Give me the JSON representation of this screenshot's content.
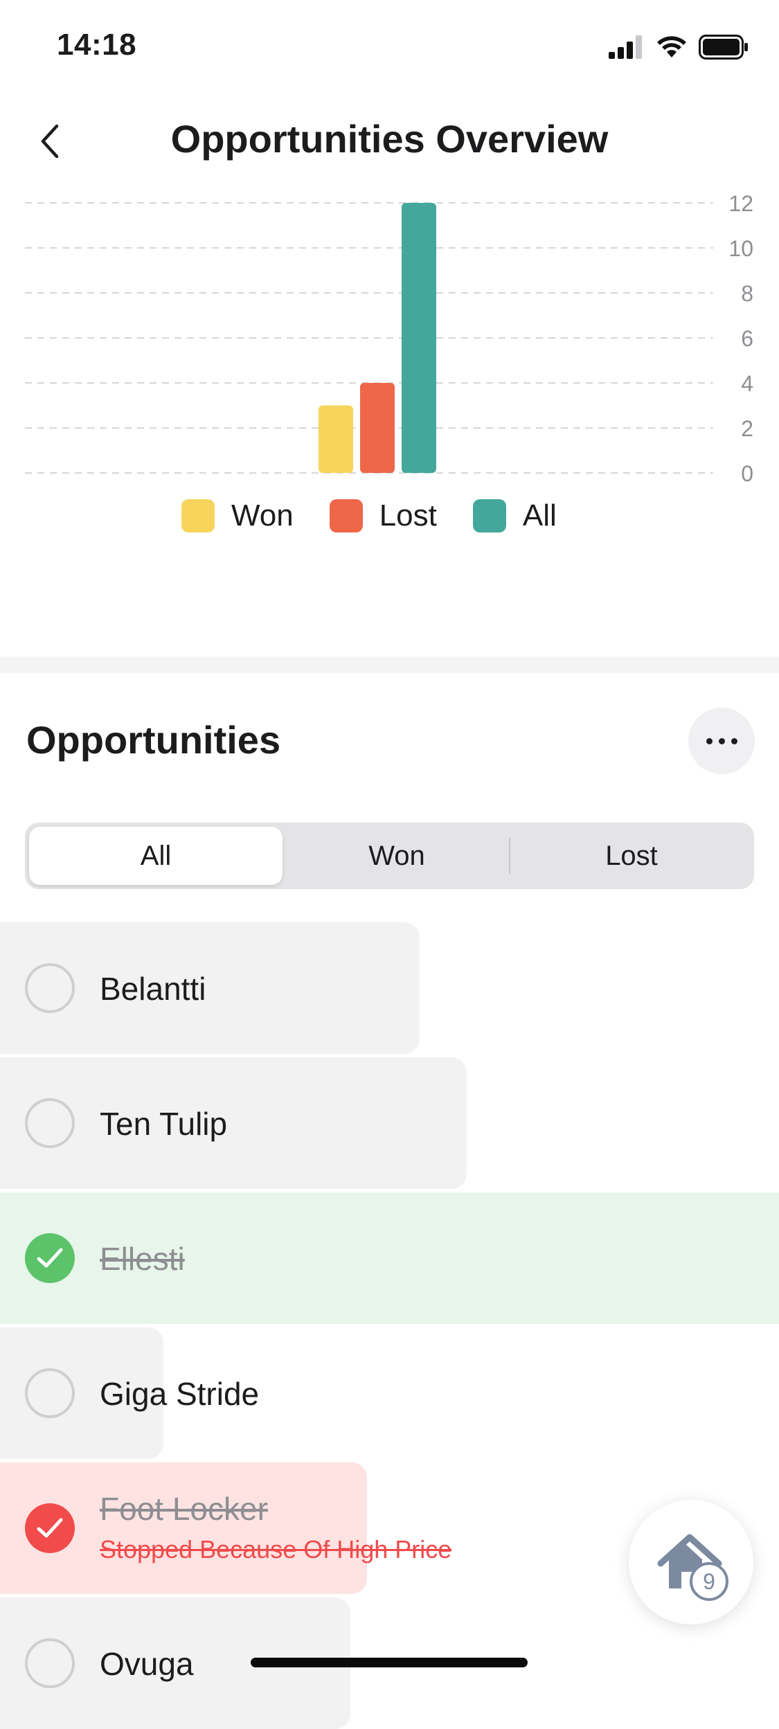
{
  "status_bar": {
    "time": "14:18"
  },
  "header": {
    "title": "Opportunities Overview"
  },
  "chart_data": {
    "type": "bar",
    "categories": [
      "Won",
      "Lost",
      "All"
    ],
    "values": [
      3,
      4,
      12
    ],
    "colors": [
      "#f7d55c",
      "#ee6749",
      "#43a89b"
    ],
    "ylim": [
      0,
      12
    ],
    "yticks": [
      "0",
      "2",
      "4",
      "6",
      "8",
      "10",
      "12"
    ],
    "grid": true,
    "legend_placement": "bottom-center"
  },
  "legend": [
    {
      "label": "Won",
      "color": "#f7d55c"
    },
    {
      "label": "Lost",
      "color": "#ee6749"
    },
    {
      "label": "All",
      "color": "#43a89b"
    }
  ],
  "section": {
    "title": "Opportunities"
  },
  "segments": [
    {
      "label": "All",
      "active": true
    },
    {
      "label": "Won",
      "active": false
    },
    {
      "label": "Lost",
      "active": false
    }
  ],
  "list": [
    {
      "name": "Belantti",
      "state": "open"
    },
    {
      "name": "Ten Tulip",
      "state": "open"
    },
    {
      "name": "Ellesti",
      "state": "won"
    },
    {
      "name": "Giga Stride",
      "state": "open"
    },
    {
      "name": "Foot Locker",
      "state": "lost",
      "reason": "Stopped Because Of High Price"
    },
    {
      "name": "Ovuga",
      "state": "open"
    }
  ],
  "fab": {
    "badge": "9"
  },
  "colors": {
    "won_row": "#e7f5ea",
    "lost_row": "#ffe3e3",
    "open_row": "#f2f2f3"
  }
}
